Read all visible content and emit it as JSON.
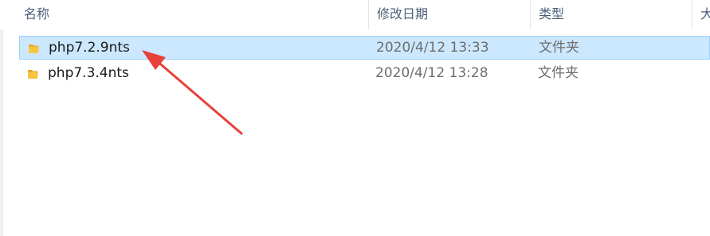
{
  "columns": {
    "name": "名称",
    "modified": "修改日期",
    "type": "类型",
    "size": "大"
  },
  "sort_indicator": "^",
  "files": [
    {
      "name": "php7.2.9nts",
      "modified": "2020/4/12 13:33",
      "type": "文件夹",
      "selected": true,
      "icon": "folder-icon"
    },
    {
      "name": "php7.3.4nts",
      "modified": "2020/4/12 13:28",
      "type": "文件夹",
      "selected": false,
      "icon": "folder-icon"
    }
  ],
  "colors": {
    "selection_bg": "#cce8ff",
    "selection_border": "#99d1ff",
    "annotation_arrow": "#e8403a",
    "folder_yellow": "#f6c643"
  }
}
